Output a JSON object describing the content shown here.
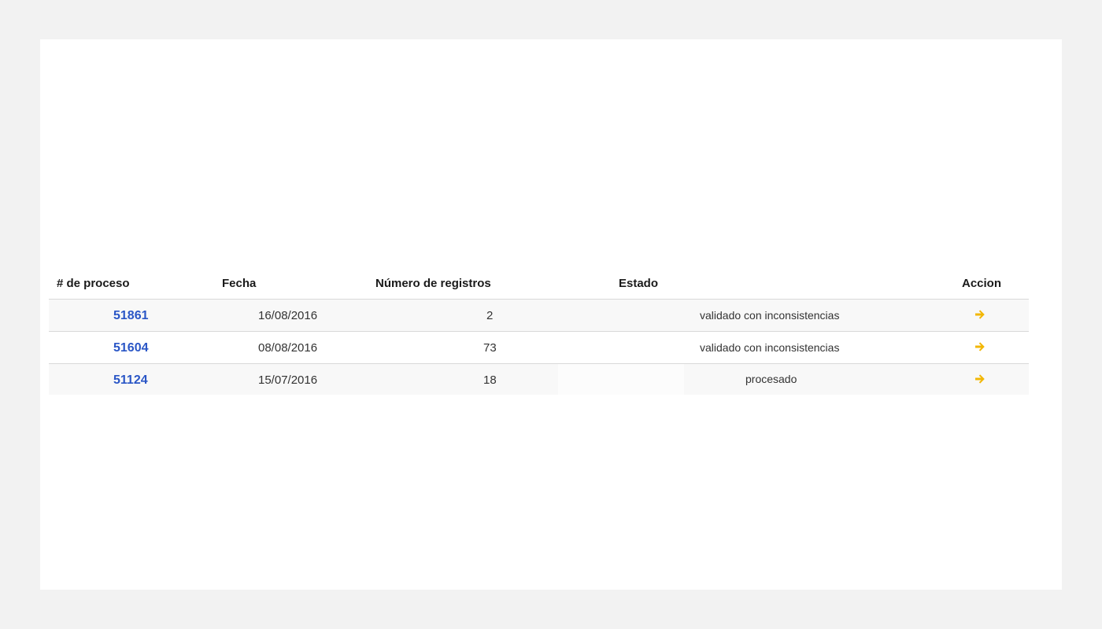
{
  "table": {
    "headers": {
      "id": "# de proceso",
      "fecha": "Fecha",
      "registros": "Número de registros",
      "estado": "Estado",
      "accion": "Accion"
    },
    "rows": [
      {
        "id": "51861",
        "fecha": "16/08/2016",
        "registros": "2",
        "estado": "validado con inconsistencias"
      },
      {
        "id": "51604",
        "fecha": "08/08/2016",
        "registros": "73",
        "estado": "validado con inconsistencias"
      },
      {
        "id": "51124",
        "fecha": "15/07/2016",
        "registros": "18",
        "estado": "procesado"
      }
    ]
  },
  "icons": {
    "action": "arrow-right-icon"
  },
  "colors": {
    "link": "#2a56c6",
    "action_icon": "#f2b705",
    "row_alt": "#f8f8f8",
    "background": "#f2f2f2"
  }
}
